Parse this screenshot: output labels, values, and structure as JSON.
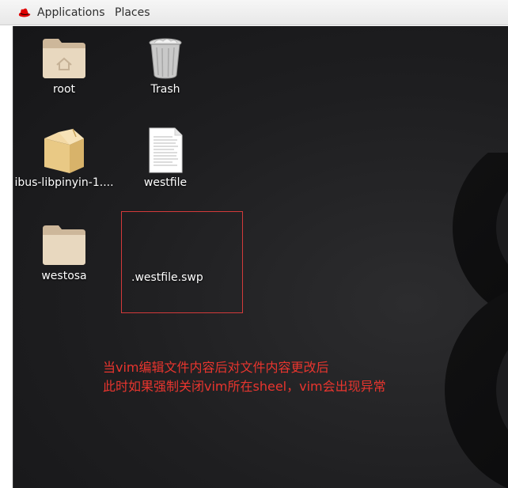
{
  "topbar": {
    "logo_icon": "redhat-icon",
    "menus": [
      {
        "label": "Applications"
      },
      {
        "label": "Places"
      }
    ]
  },
  "desktop": {
    "icons": [
      {
        "label": "root",
        "icon": "home-folder-icon"
      },
      {
        "label": "Trash",
        "icon": "trash-icon"
      },
      {
        "label": "ibus-libpinyin-1....",
        "icon": "archive-folder-icon"
      },
      {
        "label": "westfile",
        "icon": "text-file-icon"
      },
      {
        "label": "westosa",
        "icon": "folder-icon"
      },
      {
        "label": ".westfile.swp",
        "icon": "hidden-file-icon"
      }
    ],
    "annotation": {
      "line1": "当vim编辑文件内容后对文件内容更改后",
      "line2": "此时如果强制关闭vim所在sheel，vim会出现异常",
      "color": "#e8352e"
    }
  }
}
